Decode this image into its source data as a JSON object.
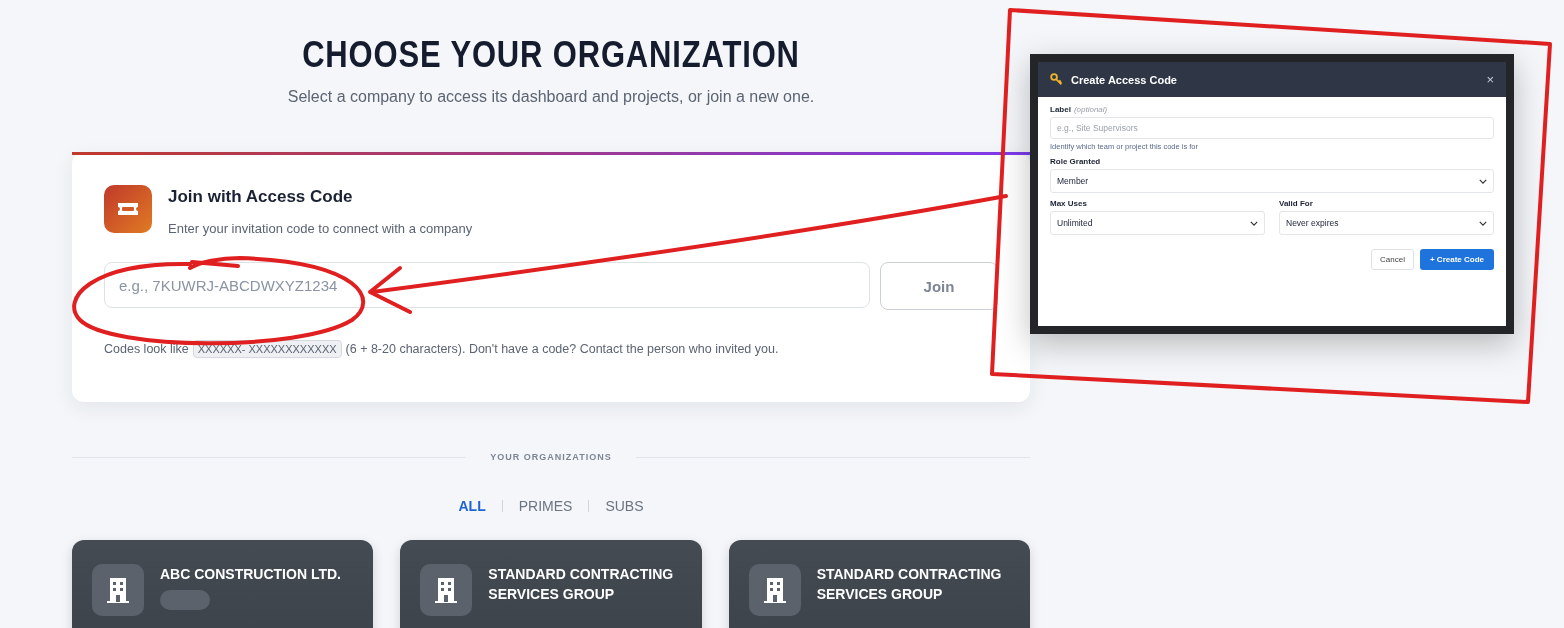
{
  "heading": "CHOOSE YOUR ORGANIZATION",
  "subheading": "Select a company to access its dashboard and projects, or join a new one.",
  "join_card": {
    "title": "Join with Access Code",
    "subtitle": "Enter your invitation code to connect with a company",
    "placeholder": "e.g., 7KUWRJ-ABCDWXYZ1234",
    "button": "Join",
    "hint_prefix": "Codes look like",
    "code_example": "XXXXXX- XXXXXXXXXXXX",
    "hint_suffix": "(6 + 8-20 characters). Don't have a code? Contact the person who invited you."
  },
  "section_label": "YOUR ORGANIZATIONS",
  "filters": [
    {
      "label": "ALL",
      "selected": true
    },
    {
      "label": "PRIMES",
      "selected": false
    },
    {
      "label": "SUBS",
      "selected": false
    }
  ],
  "organizations": [
    {
      "name": "ABC CONSTRUCTION LTD.",
      "has_tag": true
    },
    {
      "name": "STANDARD CONTRACTING SERVICES GROUP",
      "has_tag": false
    },
    {
      "name": "STANDARD CONTRACTING SERVICES GROUP",
      "has_tag": false
    }
  ],
  "dialog": {
    "title": "Create Access Code",
    "close": "×",
    "label_field": {
      "label": "Label",
      "optional": "(optional)",
      "placeholder": "e.g., Site Supervisors",
      "hint": "Identify which team or project this code is for"
    },
    "role_field": {
      "label": "Role Granted",
      "value": "Member"
    },
    "uses_field": {
      "label": "Max Uses",
      "value": "Unlimited"
    },
    "valid_field": {
      "label": "Valid For",
      "value": "Never expires"
    },
    "cancel": "Cancel",
    "create": "+ Create Code"
  }
}
